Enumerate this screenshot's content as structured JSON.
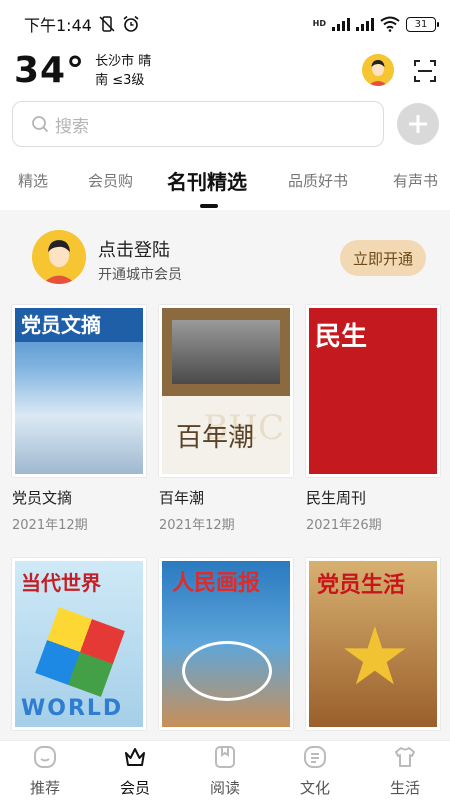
{
  "status_bar": {
    "time": "下午1:44",
    "network_tag": "HD",
    "battery": "31"
  },
  "weather": {
    "temperature": "34°",
    "city_condition": "长沙市 晴",
    "wind": "南 ≤3级"
  },
  "search": {
    "placeholder": "搜索"
  },
  "tabs": [
    {
      "label": "精选",
      "active": false
    },
    {
      "label": "会员购",
      "active": false
    },
    {
      "label": "名刊精选",
      "active": true
    },
    {
      "label": "品质好书",
      "active": false
    },
    {
      "label": "有声书",
      "active": false
    }
  ],
  "member": {
    "title": "点击登陆",
    "subtitle": "开通城市会员",
    "button": "立即开通"
  },
  "magazines": [
    {
      "name": "党员文摘",
      "issue": "2021年12期",
      "cover_title": "党员文摘"
    },
    {
      "name": "百年潮",
      "issue": "2021年12期",
      "cover_title": "百年潮"
    },
    {
      "name": "民生周刊",
      "issue": "2021年26期",
      "cover_title": "民生"
    },
    {
      "name": "",
      "issue": "",
      "cover_title": "当代世界"
    },
    {
      "name": "",
      "issue": "",
      "cover_title": "人民画报"
    },
    {
      "name": "",
      "issue": "",
      "cover_title": "党员生活"
    }
  ],
  "bottom_nav": [
    {
      "label": "推荐",
      "icon": "smile-icon",
      "active": false
    },
    {
      "label": "会员",
      "icon": "crown-icon",
      "active": true
    },
    {
      "label": "阅读",
      "icon": "book-icon",
      "active": false
    },
    {
      "label": "文化",
      "icon": "list-icon",
      "active": false
    },
    {
      "label": "生活",
      "icon": "shirt-icon",
      "active": false
    }
  ],
  "colors": {
    "member_button_bg": "#f3d9b3",
    "member_button_text": "#6b4a1c",
    "avatar_yellow": "#f7c531",
    "content_bg": "#f5f5f5"
  }
}
